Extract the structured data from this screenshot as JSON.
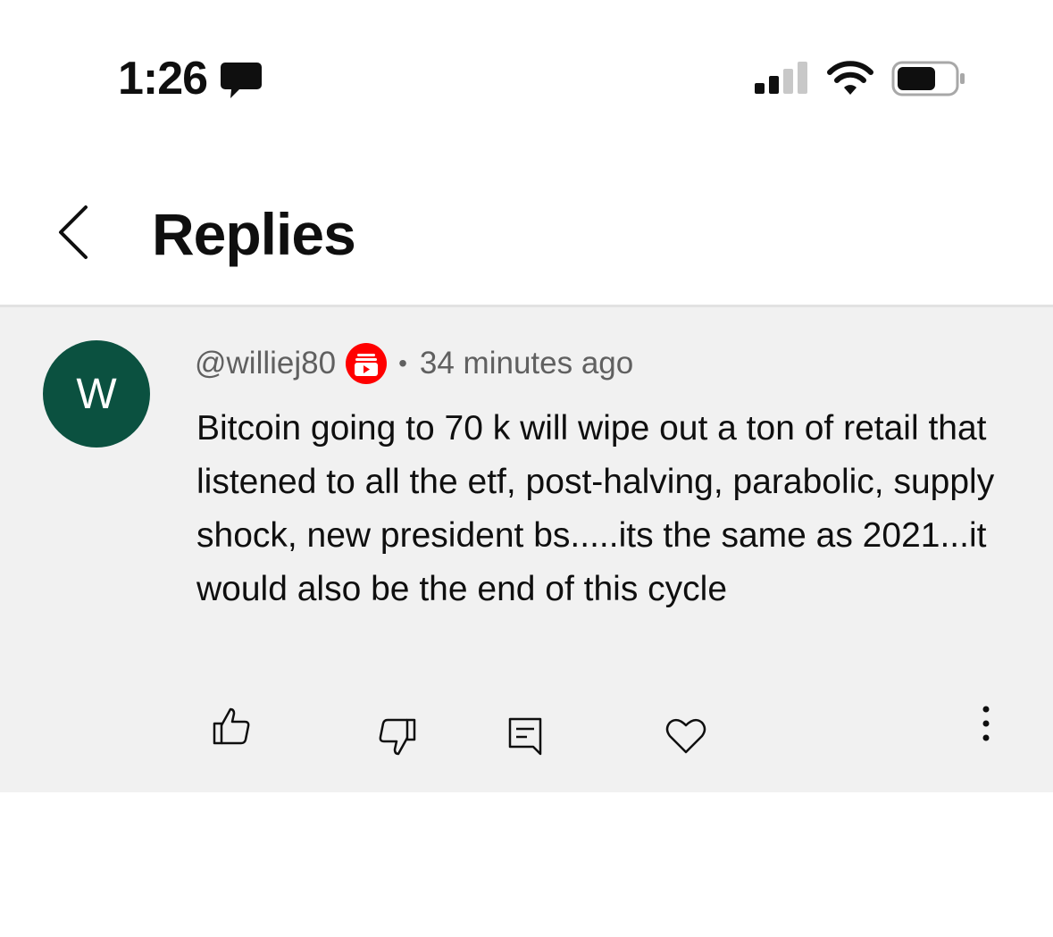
{
  "status_bar": {
    "time": "1:26",
    "icons": [
      "message-icon",
      "signal-icon",
      "wifi-icon",
      "battery-icon"
    ]
  },
  "header": {
    "title": "Replies",
    "back_icon": "chevron-left-icon"
  },
  "comment": {
    "avatar_letter": "W",
    "avatar_color": "#0b5140",
    "handle": "@williej80",
    "badge_icon": "member-badge-icon",
    "badge_color": "#ff0000",
    "separator": "•",
    "timestamp": "34 minutes ago",
    "text": "Bitcoin going to 70 k will wipe out a ton of retail that listened to all the etf, post-halving, parabolic, supply shock, new president bs.....its the same as 2021...it would also be the end of this cycle",
    "actions": [
      "thumbs-up-icon",
      "thumbs-down-icon",
      "reply-icon",
      "heart-icon",
      "more-vertical-icon"
    ]
  },
  "colors": {
    "comment_bg": "#f1f1f1",
    "divider": "#e2e2e2",
    "meta_text": "#606060"
  }
}
